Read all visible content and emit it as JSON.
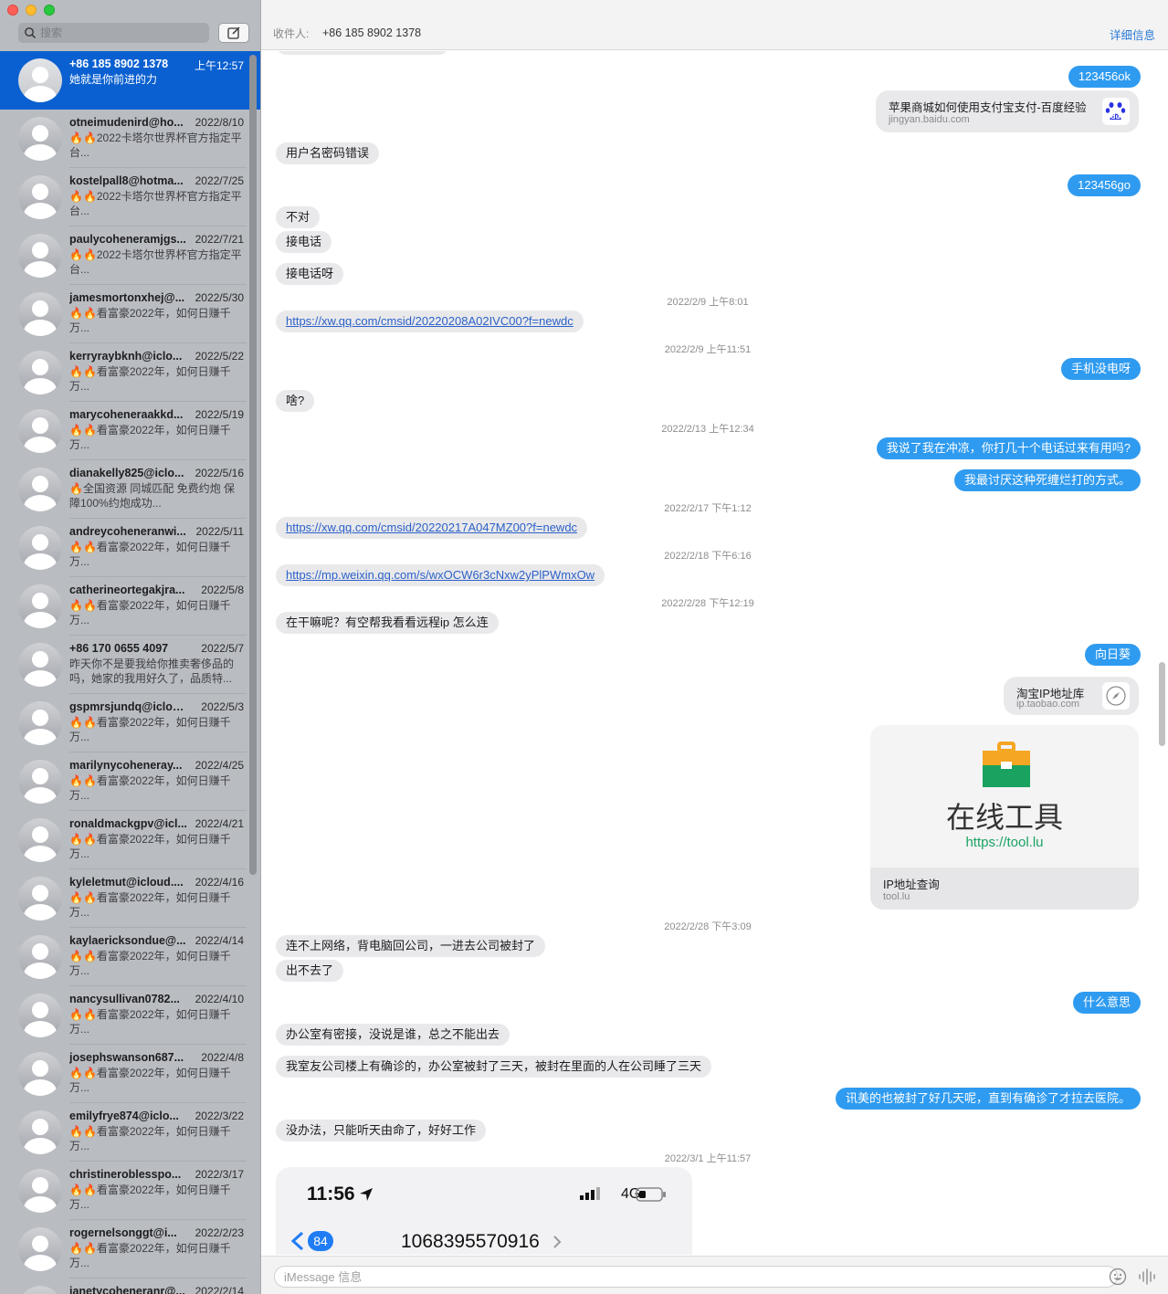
{
  "search": {
    "placeholder": "搜索"
  },
  "conversations": [
    {
      "name": "+86 185 8902 1378",
      "date": "上午12:57",
      "preview": "她就是你前进的力",
      "selected": true
    },
    {
      "name": "otneimudenird@ho...",
      "date": "2022/8/10",
      "preview": "🔥🔥2022卡塔尔世界杯官方指定平台..."
    },
    {
      "name": "kostelpall8@hotma...",
      "date": "2022/7/25",
      "preview": "🔥🔥2022卡塔尔世界杯官方指定平台..."
    },
    {
      "name": "paulycoheneramjgs...",
      "date": "2022/7/21",
      "preview": "🔥🔥2022卡塔尔世界杯官方指定平台..."
    },
    {
      "name": "jamesmortonxhej@...",
      "date": "2022/5/30",
      "preview": "🔥🔥看富豪2022年，如何日赚千万..."
    },
    {
      "name": "kerryraybknh@iclo...",
      "date": "2022/5/22",
      "preview": "🔥🔥看富豪2022年，如何日赚千万..."
    },
    {
      "name": "marycoheneraakkd...",
      "date": "2022/5/19",
      "preview": "🔥🔥看富豪2022年，如何日赚千万..."
    },
    {
      "name": "dianakelly825@iclo...",
      "date": "2022/5/16",
      "preview": "🔥全国资源 同城匹配 免费约炮 保障100%约炮成功..."
    },
    {
      "name": "andreycoheneranwi...",
      "date": "2022/5/11",
      "preview": "🔥🔥看富豪2022年，如何日赚千万..."
    },
    {
      "name": "catherineortegakjra...",
      "date": "2022/5/8",
      "preview": "🔥🔥看富豪2022年，如何日赚千万..."
    },
    {
      "name": "+86 170 0655 4097",
      "date": "2022/5/7",
      "preview": "昨天你不是要我给你推卖奢侈品的吗，她家的我用好久了，品质特..."
    },
    {
      "name": "gspmrsjundq@iclou...",
      "date": "2022/5/3",
      "preview": "🔥🔥看富豪2022年，如何日赚千万..."
    },
    {
      "name": "marilynycoheneray...",
      "date": "2022/4/25",
      "preview": "🔥🔥看富豪2022年，如何日赚千万..."
    },
    {
      "name": "ronaldmackgpv@icl...",
      "date": "2022/4/21",
      "preview": "🔥🔥看富豪2022年，如何日赚千万..."
    },
    {
      "name": "kyleletmut@icloud....",
      "date": "2022/4/16",
      "preview": "🔥🔥看富豪2022年，如何日赚千万..."
    },
    {
      "name": "kaylaericksondue@...",
      "date": "2022/4/14",
      "preview": "🔥🔥看富豪2022年，如何日赚千万..."
    },
    {
      "name": "nancysullivan0782...",
      "date": "2022/4/10",
      "preview": "🔥🔥看富豪2022年，如何日赚千万..."
    },
    {
      "name": "josephswanson687...",
      "date": "2022/4/8",
      "preview": "🔥🔥看富豪2022年，如何日赚千万..."
    },
    {
      "name": "emilyfrye874@iclo...",
      "date": "2022/3/22",
      "preview": "🔥🔥看富豪2022年，如何日赚千万..."
    },
    {
      "name": "christineroblesspo...",
      "date": "2022/3/17",
      "preview": "🔥🔥看富豪2022年，如何日赚千万..."
    },
    {
      "name": "rogernelsonggt@i...",
      "date": "2022/2/23",
      "preview": "🔥🔥看富豪2022年，如何日赚千万..."
    },
    {
      "name": "janetycoheneranr@...",
      "date": "2022/2/14",
      "preview": ""
    }
  ],
  "header": {
    "to_label": "收件人:",
    "to_value": "+86 185 8902 1378",
    "details": "详细信息"
  },
  "messages": {
    "m1": "123456ok",
    "card_baidu_title": "苹果商城如何使用支付宝支付-百度经验",
    "card_baidu_domain": "jingyan.baidu.com",
    "m2": "用户名密码错误",
    "m3": "123456go",
    "m4": "不对",
    "m5": "接电话",
    "m6": "接电话呀",
    "ts1": "2022/2/9 上午8:01",
    "m7": "https://xw.qq.com/cmsid/20220208A02IVC00?f=newdc",
    "ts2": "2022/2/9 上午11:51",
    "m8": "手机没电呀",
    "m9": "啥?",
    "ts3": "2022/2/13 上午12:34",
    "m10": "我说了我在冲凉，你打几十个电话过来有用吗?",
    "m11": "我最讨厌这种死缠烂打的方式。",
    "ts4": "2022/2/17 下午1:12",
    "m12": "https://xw.qq.com/cmsid/20220217A047MZ00?f=newdc",
    "ts5": "2022/2/18 下午6:16",
    "m13": "https://mp.weixin.qq.com/s/wxOCW6r3cNxw2yPlPWmxOw",
    "ts6": "2022/2/28 下午12:19",
    "m14": "在干嘛呢？有空帮我看看远程ip 怎么连",
    "m15": "向日葵",
    "card_taobao_title": "淘宝IP地址库",
    "card_taobao_domain": "ip.taobao.com",
    "card_tool_headline": "在线工具",
    "card_tool_url": "https://tool.lu",
    "card_tool_title": "IP地址查询",
    "card_tool_domain": "tool.lu",
    "ts7": "2022/2/28 下午3:09",
    "m16": "连不上网络，背电脑回公司，一进去公司被封了",
    "m17": "出不去了",
    "m18": "什么意思",
    "m19": "办公室有密接，没说是谁，总之不能出去",
    "m20": "我室友公司楼上有确诊的，办公室被封了三天，被封在里面的人在公司睡了三天",
    "m21": "讯美的也被封了好几天呢，直到有确诊了才拉去医院。",
    "m22": "没办法，只能听天由命了，好好工作",
    "ts8": "2022/3/1 上午11:57",
    "shot_time": "11:56",
    "shot_net": "4G",
    "shot_badge": "84",
    "shot_number": "1068395570916"
  },
  "compose": {
    "placeholder": "iMessage 信息"
  },
  "colors": {
    "accent": "#0a60d0",
    "bubble_out": "#2f9bf0",
    "bubble_in": "#e9e9eb",
    "link": "#2c61c9"
  }
}
